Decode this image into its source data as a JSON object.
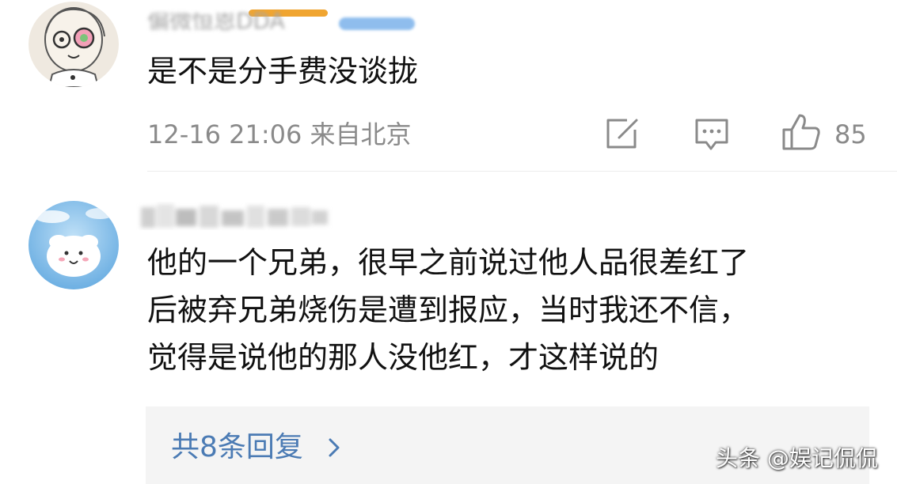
{
  "comment1": {
    "username": "偏微恒恩DDA",
    "text": "是不是分手费没谈拢",
    "meta": "12-16 21:06 来自北京",
    "like_count": "85",
    "icons": {
      "share": "share-icon",
      "comment": "comment-icon",
      "like": "thumbs-up-icon"
    }
  },
  "comment2": {
    "text_lines": [
      "他的一个兄弟，很早之前说过他人品很差红了",
      "后被弃兄弟烧伤是遭到报应，当时我还不信，",
      "觉得是说他的那人没他红，才这样说的"
    ],
    "replies_label": "共8条回复",
    "replies_icon": "chevron-right-icon"
  },
  "watermark": "头条 @娱记侃侃",
  "colors": {
    "accent_bar": "#f0a531",
    "link_blue": "#4b7bb4",
    "meta_gray": "#8a8a8a",
    "reply_box_bg": "#f4f4f4"
  }
}
